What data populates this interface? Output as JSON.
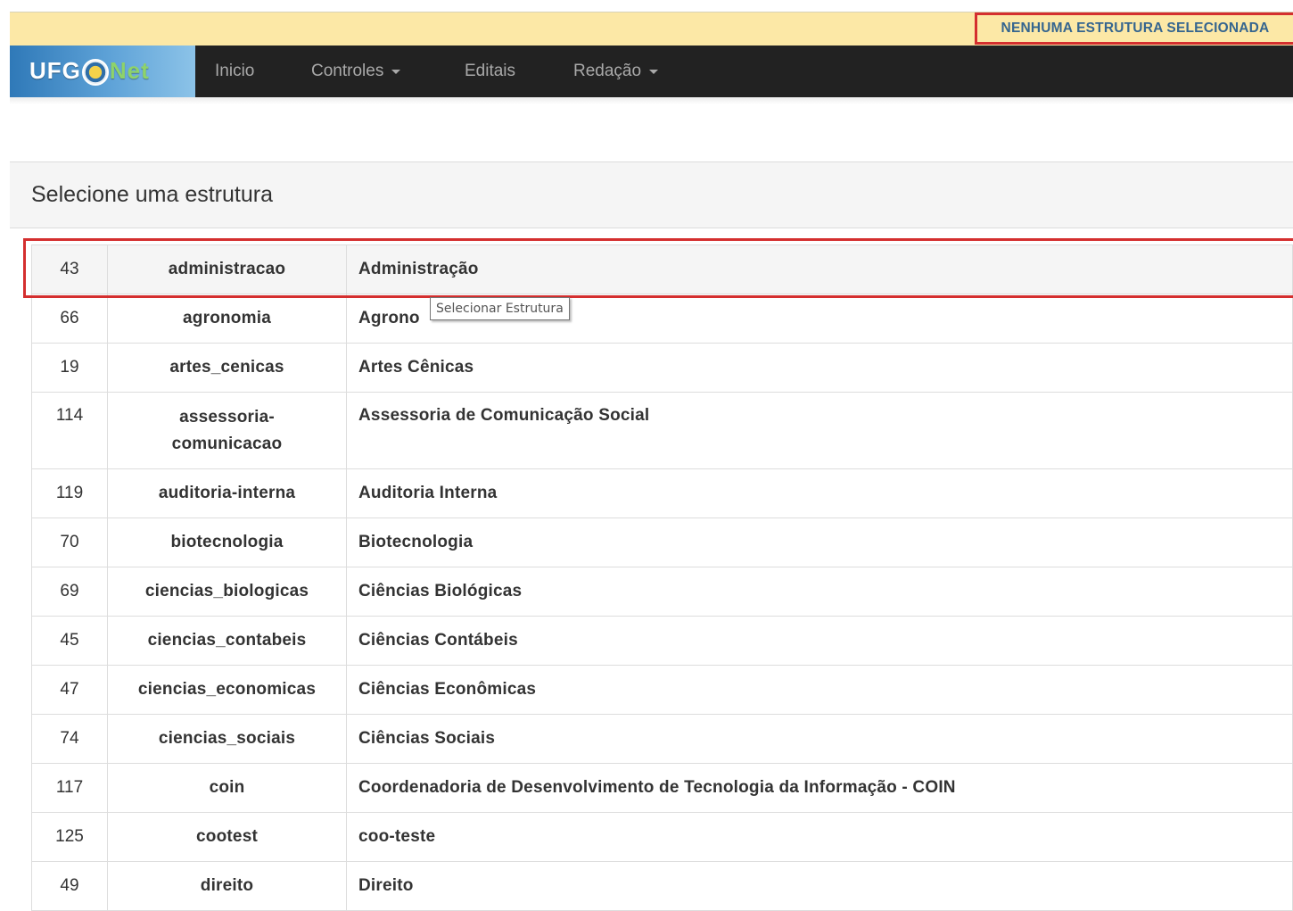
{
  "status": {
    "label": "NENHUMA ESTRUTURA SELECIONADA"
  },
  "brand": {
    "part1": "UFG",
    "part2": "Net"
  },
  "nav": {
    "items": [
      {
        "label": "Inicio",
        "dropdown": false
      },
      {
        "label": "Controles",
        "dropdown": true
      },
      {
        "label": "Editais",
        "dropdown": false
      },
      {
        "label": "Redação",
        "dropdown": true
      }
    ]
  },
  "panel": {
    "title": "Selecione uma estrutura"
  },
  "tooltip": {
    "text": "Selecionar Estrutura"
  },
  "table": {
    "rows": [
      {
        "id": "43",
        "slug": "administracao",
        "name": "Administração"
      },
      {
        "id": "66",
        "slug": "agronomia",
        "name": "Agrono"
      },
      {
        "id": "19",
        "slug": "artes_cenicas",
        "name": "Artes Cênicas"
      },
      {
        "id": "114",
        "slug": "assessoria-comunicacao",
        "name": "Assessoria de Comunicação Social"
      },
      {
        "id": "119",
        "slug": "auditoria-interna",
        "name": "Auditoria Interna"
      },
      {
        "id": "70",
        "slug": "biotecnologia",
        "name": "Biotecnologia"
      },
      {
        "id": "69",
        "slug": "ciencias_biologicas",
        "name": "Ciências Biológicas"
      },
      {
        "id": "45",
        "slug": "ciencias_contabeis",
        "name": "Ciências Contábeis"
      },
      {
        "id": "47",
        "slug": "ciencias_economicas",
        "name": "Ciências Econômicas"
      },
      {
        "id": "74",
        "slug": "ciencias_sociais",
        "name": "Ciências Sociais"
      },
      {
        "id": "117",
        "slug": "coin",
        "name": "Coordenadoria de Desenvolvimento de Tecnologia da Informação - COIN"
      },
      {
        "id": "125",
        "slug": "cootest",
        "name": "coo-teste"
      },
      {
        "id": "49",
        "slug": "direito",
        "name": "Direito"
      }
    ]
  },
  "colors": {
    "status_bg": "#fce8a6",
    "status_text": "#35658f",
    "highlight": "#d42f2f",
    "navbar_bg": "#222222",
    "nav_text": "#a9a9a9"
  }
}
